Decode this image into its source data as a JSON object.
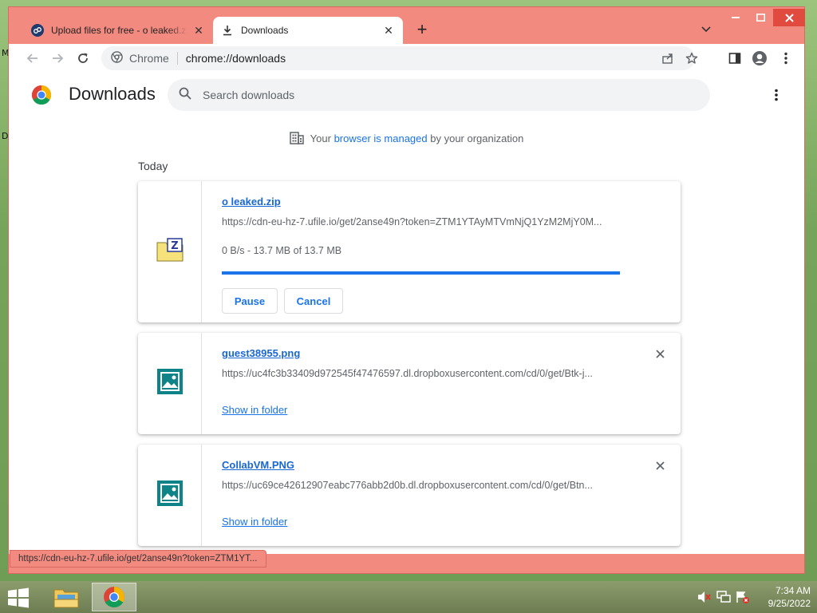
{
  "desktop": {
    "glyph_top": "M",
    "glyph_mid": "D"
  },
  "tabs": [
    {
      "title": "Upload files for free - o leaked.zip - ufile.io",
      "icon": "ufile-favicon-icon"
    },
    {
      "title": "Downloads",
      "icon": "download-icon"
    }
  ],
  "omnibox": {
    "scheme_label": "Chrome",
    "url": "chrome://downloads"
  },
  "page": {
    "title": "Downloads",
    "search_placeholder": "Search downloads",
    "managed_prefix": "Your ",
    "managed_link": "browser is managed",
    "managed_suffix": " by your organization",
    "section_date": "Today"
  },
  "downloads": [
    {
      "name": "o leaked.zip",
      "url": "https://cdn-eu-hz-7.ufile.io/get/2anse49n?token=ZTM1YTAyMTVmNjQ1YzM2MjY0M...",
      "status": "0 B/s - 13.7 MB of 13.7 MB",
      "progress": 1.0,
      "pause_label": "Pause",
      "cancel_label": "Cancel"
    },
    {
      "name": "guest38955.png",
      "url": "https://uc4fc3b33409d972545f47476597.dl.dropboxusercontent.com/cd/0/get/Btk-j...",
      "link_label": "Show in folder"
    },
    {
      "name": "CollabVM.PNG",
      "url": "https://uc69ce42612907eabc776abb2d0b.dl.dropboxusercontent.com/cd/0/get/Btn...",
      "link_label": "Show in folder"
    }
  ],
  "status_bubble": "https://cdn-eu-hz-7.ufile.io/get/2anse49n?token=ZTM1YT...",
  "taskbar": {
    "time": "7:34 AM",
    "date": "9/25/2022"
  },
  "colors": {
    "window_frame": "#f28a80",
    "accent": "#1a73e8",
    "link": "#1967d2"
  }
}
